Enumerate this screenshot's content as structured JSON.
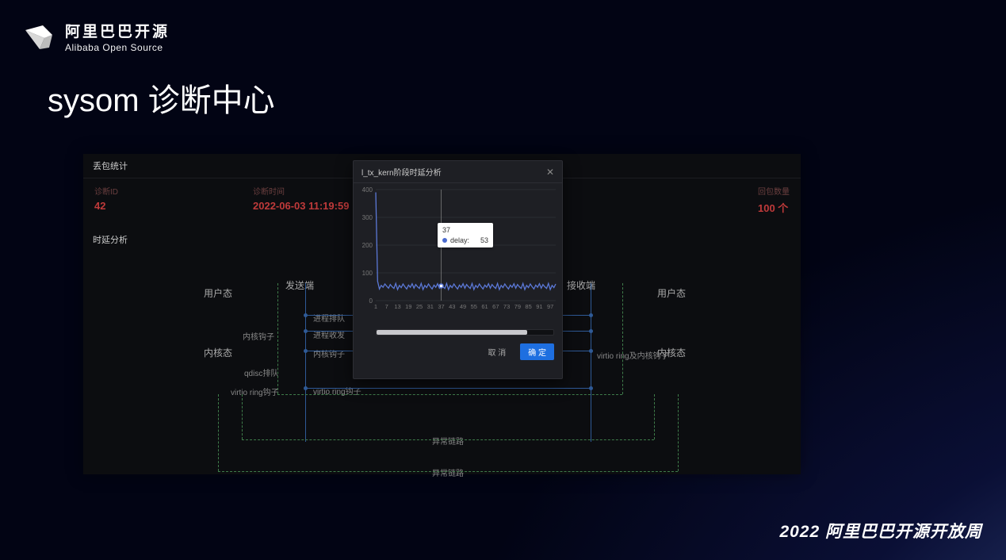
{
  "brand": {
    "cn": "阿里巴巴开源",
    "en": "Alibaba Open Source"
  },
  "slide_title": "sysom 诊断中心",
  "footer": "2022 阿里巴巴开源开放周",
  "stats_panel": {
    "title": "丢包统计",
    "items": [
      {
        "label": "诊断ID",
        "value": "42"
      },
      {
        "label": "诊断时间",
        "value": "2022-06-03 11:19:59"
      },
      {
        "label": "回包数量",
        "value": "100 个"
      }
    ]
  },
  "delay_panel": {
    "title": "时延分析",
    "labels": {
      "user_left": "用户态",
      "user_right": "用户态",
      "sender": "发送端",
      "receiver": "接收端",
      "kernel_left": "内核态",
      "kernel_right": "内核态"
    },
    "nodes": {
      "n1": "内核钩子",
      "n2": "qdisc排队",
      "n3": "virtio ring钩子",
      "n4": "进程排队",
      "n5": "进程收发",
      "n6": "内核钩子",
      "n7": "virtio ring钩子",
      "n8": "异常链路",
      "n9": "异常链路",
      "n10": "virtio ring及内核钩子"
    }
  },
  "modal": {
    "title": "l_tx_kern阶段时延分析",
    "cancel": "取 消",
    "ok": "确 定",
    "tooltip": {
      "x": "37",
      "series": "delay:",
      "value": "53"
    }
  },
  "chart_data": {
    "type": "line",
    "title": "l_tx_kern阶段时延分析",
    "xlabel": "",
    "ylabel": "",
    "ylim": [
      0,
      400
    ],
    "y_ticks": [
      0,
      100,
      200,
      300,
      400
    ],
    "x_ticks": [
      1,
      7,
      13,
      19,
      25,
      31,
      37,
      43,
      49,
      55,
      61,
      67,
      73,
      79,
      85,
      91,
      97
    ],
    "series": [
      {
        "name": "delay",
        "color": "#5b78d6",
        "values": [
          390,
          70,
          42,
          55,
          48,
          60,
          52,
          45,
          58,
          50,
          44,
          62,
          40,
          55,
          47,
          60,
          50,
          42,
          56,
          48,
          61,
          45,
          58,
          50,
          44,
          62,
          40,
          55,
          47,
          60,
          50,
          42,
          56,
          48,
          61,
          45,
          53,
          50,
          44,
          62,
          40,
          55,
          47,
          60,
          50,
          42,
          56,
          48,
          61,
          45,
          58,
          50,
          44,
          62,
          40,
          55,
          47,
          60,
          50,
          42,
          56,
          48,
          61,
          45,
          58,
          50,
          44,
          62,
          40,
          55,
          47,
          60,
          50,
          42,
          56,
          48,
          61,
          45,
          58,
          50,
          44,
          62,
          40,
          55,
          47,
          60,
          50,
          42,
          56,
          48,
          61,
          45,
          58,
          50,
          44,
          62,
          40,
          55,
          47,
          60
        ]
      }
    ],
    "highlight": {
      "x": 37,
      "value": 53
    }
  }
}
